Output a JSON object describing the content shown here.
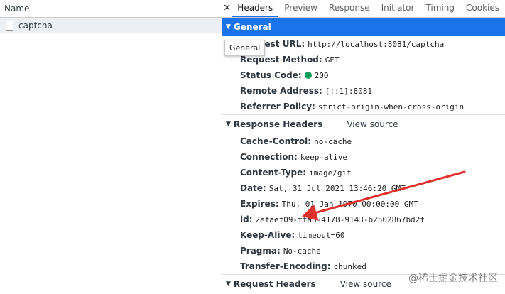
{
  "left": {
    "header": "Name",
    "rows": [
      {
        "name": "captcha"
      }
    ]
  },
  "tabs": {
    "close_symbol": "✕",
    "items": [
      {
        "label": "Headers",
        "active": true
      },
      {
        "label": "Preview"
      },
      {
        "label": "Response"
      },
      {
        "label": "Initiator"
      },
      {
        "label": "Timing"
      },
      {
        "label": "Cookies"
      }
    ]
  },
  "general": {
    "title": "General",
    "tooltip": "General",
    "rows": [
      {
        "key": "Request URL:",
        "value": "http://localhost:8081/captcha"
      },
      {
        "key": "Request Method:",
        "value": "GET"
      },
      {
        "key": "Status Code:",
        "value": "200"
      },
      {
        "key": "Remote Address:",
        "value": "[::1]:8081"
      },
      {
        "key": "Referrer Policy:",
        "value": "strict-origin-when-cross-origin"
      }
    ],
    "status_color": "#0f9d58"
  },
  "response_headers": {
    "title": "Response Headers",
    "view_source": "View source",
    "rows": [
      {
        "key": "Cache-Control:",
        "value": "no-cache"
      },
      {
        "key": "Connection:",
        "value": "keep-alive"
      },
      {
        "key": "Content-Type:",
        "value": "image/gif"
      },
      {
        "key": "Date:",
        "value": "Sat, 31 Jul 2021 13:46:20 GMT"
      },
      {
        "key": "Expires:",
        "value": "Thu, 01 Jan 1970 00:00:00 GMT"
      },
      {
        "key": "id:",
        "value": "2efaef09-ffa8-4178-9143-b2502867bd2f"
      },
      {
        "key": "Keep-Alive:",
        "value": "timeout=60"
      },
      {
        "key": "Pragma:",
        "value": "No-cache"
      },
      {
        "key": "Transfer-Encoding:",
        "value": "chunked"
      }
    ]
  },
  "request_headers": {
    "title": "Request Headers",
    "view_source": "View source"
  },
  "watermark": "@稀土掘金技术社区",
  "colors": {
    "accent": "#1a73e8",
    "arrow": "#e0302b"
  }
}
